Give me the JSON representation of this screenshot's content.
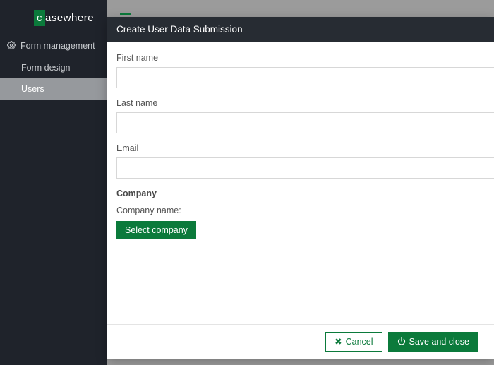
{
  "brand": {
    "name": "casewhere"
  },
  "sidebar": {
    "section_label": "Form management",
    "items": [
      {
        "label": "Form design",
        "active": false
      },
      {
        "label": "Users",
        "active": true
      }
    ]
  },
  "modal": {
    "title": "Create User Data Submission",
    "fields": {
      "first_name": {
        "label": "First name",
        "value": ""
      },
      "last_name": {
        "label": "Last name",
        "value": ""
      },
      "email": {
        "label": "Email",
        "value": ""
      }
    },
    "company": {
      "section_title": "Company",
      "name_label": "Company name:",
      "select_button": "Select company"
    },
    "footer": {
      "cancel": "Cancel",
      "save": "Save and close"
    }
  }
}
